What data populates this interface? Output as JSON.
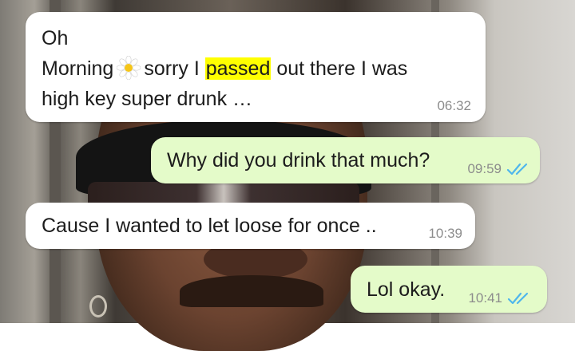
{
  "chat": {
    "messages": [
      {
        "direction": "incoming",
        "line1": "Oh",
        "line2_before": "Morning",
        "emoji": "daisy-emoji",
        "line2_mid": "sorry I",
        "highlight": "passed",
        "line2_after": "out there I was",
        "line3": "high key super drunk …",
        "time": "06:32"
      },
      {
        "direction": "outgoing",
        "text": "Why did you drink that much?",
        "time": "09:59",
        "status": "read"
      },
      {
        "direction": "incoming",
        "text": "Cause I wanted to let loose for once ..",
        "time": "10:39"
      },
      {
        "direction": "outgoing",
        "text": "Lol okay.",
        "time": "10:41",
        "status": "read"
      }
    ]
  },
  "colors": {
    "incoming_bubble": "#ffffff",
    "outgoing_bubble": "#e4fbc9",
    "read_ticks": "#4fb6ec",
    "highlight": "#ffff00"
  }
}
